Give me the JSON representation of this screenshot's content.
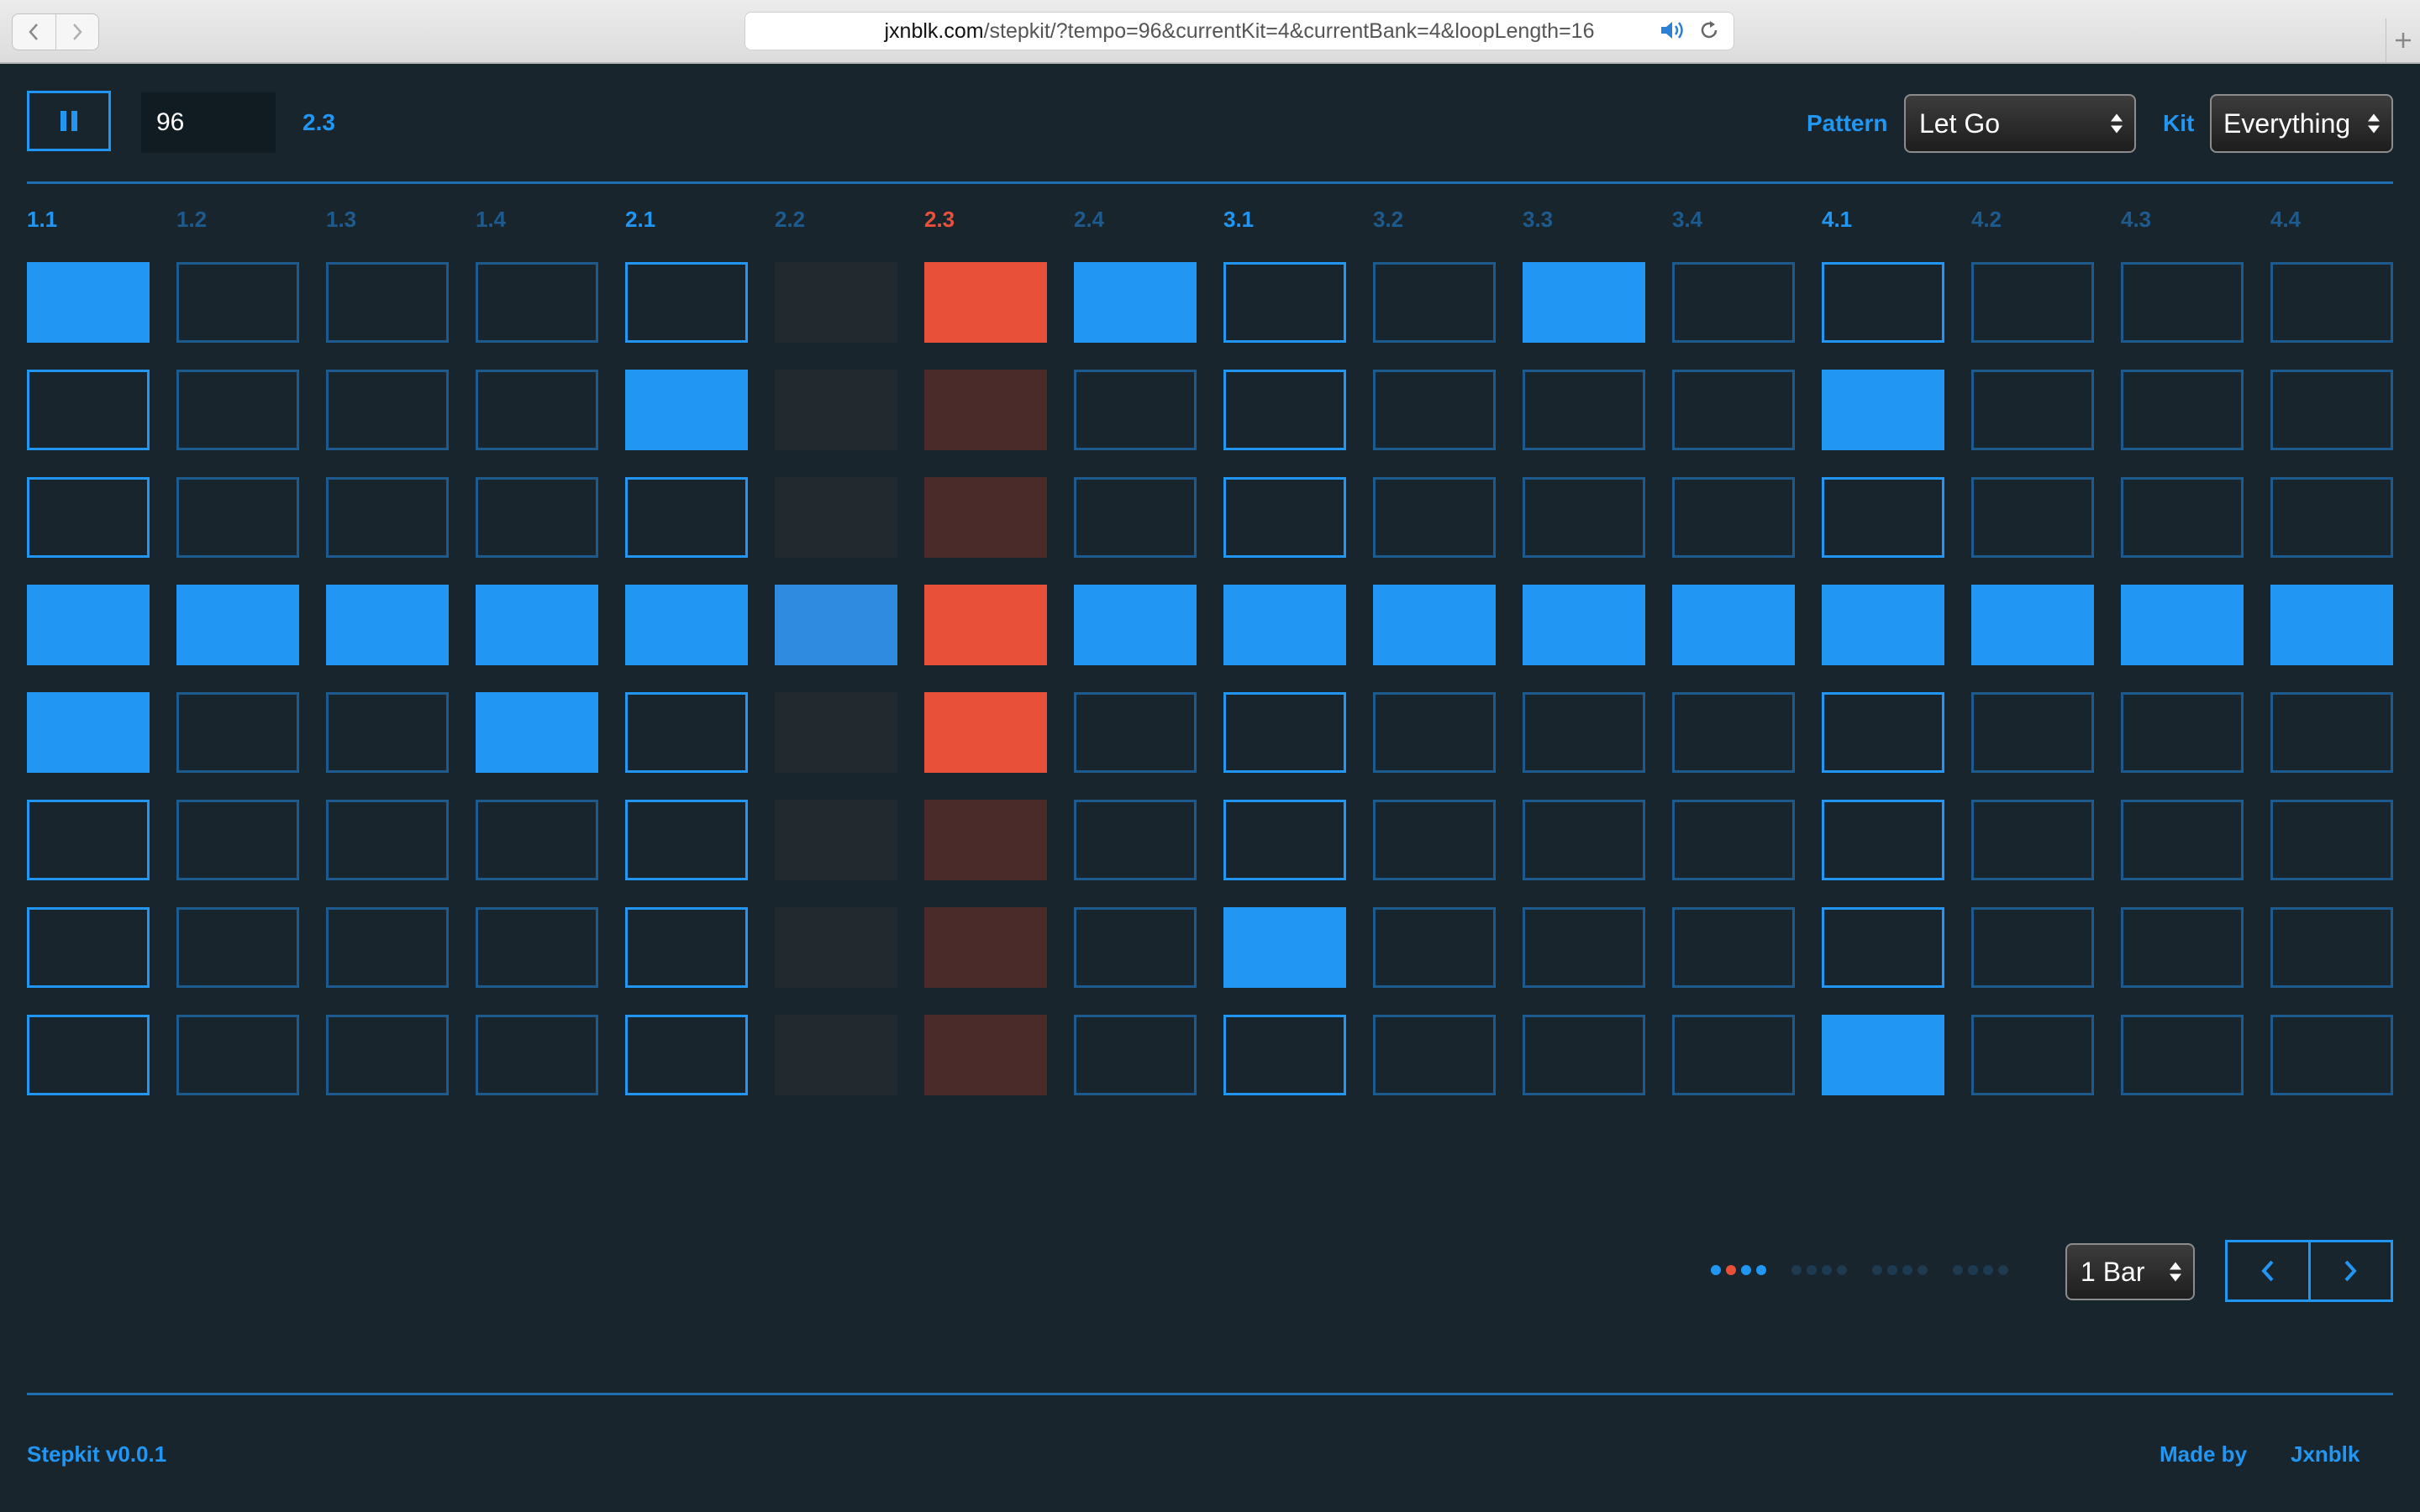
{
  "browser": {
    "url_host": "jxnblk.com",
    "url_rest": "/stepkit/?tempo=96&currentKit=4&currentBank=4&loopLength=16"
  },
  "controls": {
    "tempo": "96",
    "position": "2.3",
    "pattern_label": "Pattern",
    "pattern_value": "Let Go",
    "kit_label": "Kit",
    "kit_value": "Everything"
  },
  "sequencer": {
    "step_labels": [
      "1.1",
      "1.2",
      "1.3",
      "1.4",
      "2.1",
      "2.2",
      "2.3",
      "2.4",
      "3.1",
      "3.2",
      "3.3",
      "3.4",
      "4.1",
      "4.2",
      "4.3",
      "4.4"
    ],
    "current_step_index": 6,
    "pattern": [
      [
        1,
        0,
        0,
        0,
        0,
        0,
        1,
        1,
        0,
        0,
        1,
        0,
        0,
        0,
        0,
        0
      ],
      [
        0,
        0,
        0,
        0,
        1,
        0,
        0,
        0,
        0,
        0,
        0,
        0,
        1,
        0,
        0,
        0
      ],
      [
        0,
        0,
        0,
        0,
        0,
        0,
        0,
        0,
        0,
        0,
        0,
        0,
        0,
        0,
        0,
        0
      ],
      [
        1,
        1,
        1,
        1,
        1,
        1,
        1,
        1,
        1,
        1,
        1,
        1,
        1,
        1,
        1,
        1
      ],
      [
        1,
        0,
        0,
        1,
        0,
        0,
        1,
        0,
        0,
        0,
        0,
        0,
        0,
        0,
        0,
        0
      ],
      [
        0,
        0,
        0,
        0,
        0,
        0,
        0,
        0,
        0,
        0,
        0,
        0,
        0,
        0,
        0,
        0
      ],
      [
        0,
        0,
        0,
        0,
        0,
        0,
        0,
        0,
        1,
        0,
        0,
        0,
        0,
        0,
        0,
        0
      ],
      [
        0,
        0,
        0,
        0,
        0,
        0,
        0,
        0,
        0,
        0,
        0,
        0,
        1,
        0,
        0,
        0
      ]
    ]
  },
  "bottom": {
    "loop_length": "1 Bar",
    "bank_dots": [
      [
        "active",
        "current",
        "active",
        "active"
      ],
      [
        "inactive",
        "inactive",
        "inactive",
        "inactive"
      ],
      [
        "inactive",
        "inactive",
        "inactive",
        "inactive"
      ],
      [
        "inactive",
        "inactive",
        "inactive",
        "inactive"
      ]
    ]
  },
  "footer": {
    "version": "Stepkit v0.0.1",
    "made_by_label": "Made by",
    "author": "Jxnblk"
  },
  "colors": {
    "background": "#18252d",
    "accent": "#2196f3",
    "playhead": "#e8503a"
  }
}
